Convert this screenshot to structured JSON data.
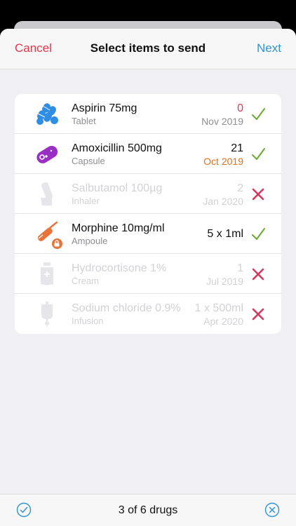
{
  "nav": {
    "cancel_label": "Cancel",
    "title": "Select items to send",
    "next_label": "Next"
  },
  "items": [
    {
      "name": "Aspirin 75mg",
      "form": "Tablet",
      "quantity": "0",
      "expiry": "Nov 2019",
      "icon": "tablet-icon",
      "selected": true
    },
    {
      "name": "Amoxicillin 500mg",
      "form": "Capsule",
      "quantity": "21",
      "expiry": "Oct 2019",
      "icon": "capsule-icon",
      "selected": true
    },
    {
      "name": "Salbutamol 100µg",
      "form": "Inhaler",
      "quantity": "2",
      "expiry": "Jan 2020",
      "icon": "inhaler-icon",
      "selected": false
    },
    {
      "name": "Morphine 10mg/ml",
      "form": "Ampoule",
      "quantity": "5 x 1ml",
      "expiry": "",
      "icon": "ampoule-icon",
      "selected": true
    },
    {
      "name": "Hydrocortisone 1%",
      "form": "Cream",
      "quantity": "1",
      "expiry": "Jul 2019",
      "icon": "cream-icon",
      "selected": false
    },
    {
      "name": "Sodium chloride 0.9%",
      "form": "Infusion",
      "quantity": "1 x 500ml",
      "expiry": "Apr 2020",
      "icon": "infusion-icon",
      "selected": false
    }
  ],
  "toolbar": {
    "count_label": "3 of 6 drugs"
  },
  "colors": {
    "accent_blue": "#2f94d5",
    "cancel_red": "#e0394c",
    "check_green": "#6aaa2e",
    "cross_red": "#d9365c",
    "warning_orange": "#e1711c",
    "tablet_blue": "#2f8de4",
    "capsule_purple": "#9b2fc4",
    "ampoule_orange": "#e8743b"
  }
}
